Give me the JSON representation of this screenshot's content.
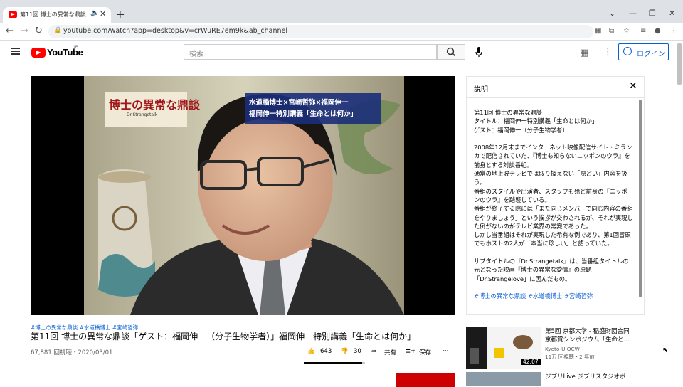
{
  "browser": {
    "tab_title": "第11回 博士の異常な鼎談「ゲ",
    "url": "youtube.com/watch?app=desktop&v=crWuRE7em9k&ab_channel"
  },
  "header": {
    "logo_text": "YouTube",
    "logo_region": "JP",
    "search_placeholder": "検索",
    "login_label": "ログイン"
  },
  "video": {
    "overlay_logo": "博士の異常な鼎談",
    "overlay_logo_sub": "Dr.Strangetalk",
    "overlay_caption_line1": "水道橋博士×宮崎哲弥×福岡伸一",
    "overlay_caption_line2": "福岡伸一特別講義「生命とは何か」",
    "hashtags": "#博士の異常な鼎談 #水道橋博士 #宮崎哲弥",
    "title": "第11回 博士の異常な鼎談「ゲスト：福岡伸一（分子生物学者）」福岡伸一特別講義「生命とは何か」",
    "meta": "67,881 回視聴・2020/03/01",
    "likes": "643",
    "dislikes": "30",
    "share_label": "共有",
    "save_label": "保存",
    "like_ratio": 0.955
  },
  "description": {
    "header": "説明",
    "lines": [
      "第11回 博士の異常な鼎談",
      "タイトル：福岡伸一特別講義「生命とは何か」",
      "ゲスト：福岡伸一（分子生物学者）",
      "",
      "2008年12月末までインターネット映像配信サイト・ミランカで配信されていた、『博士も知らないニッポンのウラ』を前身とする対談番組。",
      "通常の地上波テレビでは取り扱えない「際どい」内容を扱う。",
      "番組のスタイルや出演者、スタッフも殆ど前身の『ニッポンのウラ』を踏襲している。",
      "番組が終了する際には「また同じメンバーで同じ内容の番組をやりましょう」という挨拶が交わされるが、それが実現した例がないのがテレビ業界の常識であった。",
      "しかし当番組はそれが実現した希有な例であり、第1回冒頭でもホストの2人が「本当に珍しい」と語っていた。",
      "",
      "サブタイトルの『Dr.Strangetalk』は、当番組タイトルの元となった映画『博士の異常な愛情』の原題「Dr.Strangelove」に因んだもの。"
    ],
    "hashtags": "#博士の異常な鼎談 #水道橋博士 #宮崎哲弥"
  },
  "related": [
    {
      "title": "第5回 京都大学 - 稲盛財団合同京都賞シンポジウム「生命と…",
      "channel": "Kyoto-U OCW",
      "views": "11万 回視聴・2 年前",
      "duration": "42:07"
    },
    {
      "title": "ジブリLive ジブリスタジオポ"
    }
  ]
}
